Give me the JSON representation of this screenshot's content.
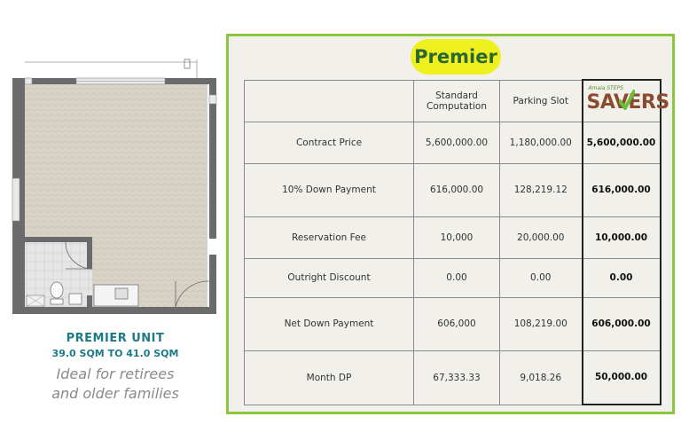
{
  "unit": {
    "title": "PREMIER UNIT",
    "size": "39.0 SQM TO 41.0 SQM",
    "description_line1": "Ideal for retirees",
    "description_line2": "and older families"
  },
  "panel": {
    "badge": "Premier",
    "headers": [
      "",
      "Standard Computation",
      "Parking Slot",
      "Amaia STEPS Savers"
    ],
    "logo": {
      "top_text": "Amaia STEPS",
      "main_text": "SAVERS"
    },
    "rows": [
      {
        "label": "Contract Price",
        "standard": "5,600,000.00",
        "parking": "1,180,000.00",
        "savers": "5,600,000.00"
      },
      {
        "label": "10% Down Payment",
        "standard": "616,000.00",
        "parking": "128,219.12",
        "savers": "616,000.00"
      },
      {
        "label": "Reservation Fee",
        "standard": "10,000",
        "parking": "20,000.00",
        "savers": "10,000.00"
      },
      {
        "label": "Outright Discount",
        "standard": "0.00",
        "parking": "0.00",
        "savers": "0.00"
      },
      {
        "label": "Net Down Payment",
        "standard": "606,000",
        "parking": "108,219.00",
        "savers": "606,000.00"
      },
      {
        "label": "Month DP",
        "standard": "67,333.33",
        "parking": "9,018.26",
        "savers": "50,000.00"
      }
    ]
  },
  "colors": {
    "accent_green": "#8cc63f",
    "badge_yellow": "#eef11e",
    "caption_teal": "#1d7a86"
  }
}
